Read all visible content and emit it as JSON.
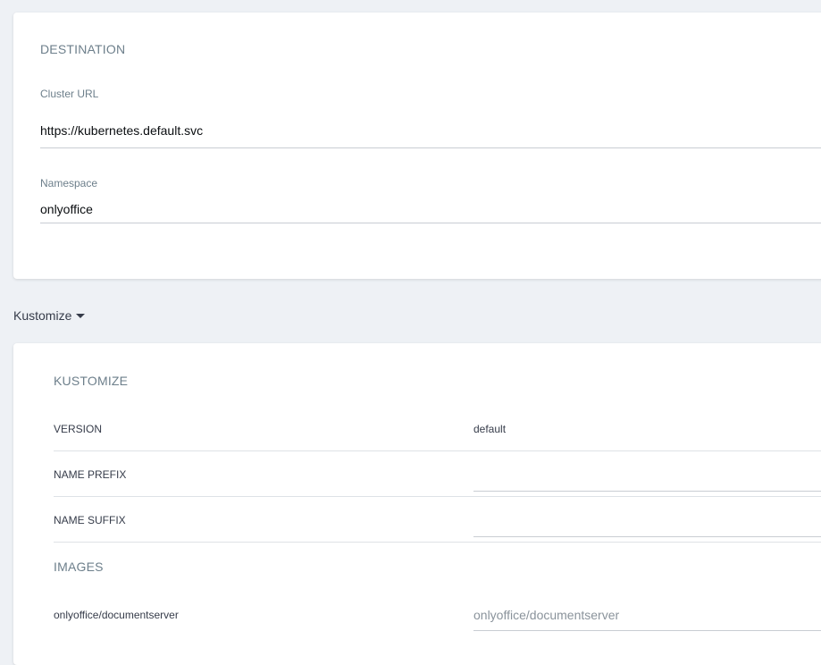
{
  "destination": {
    "title": "DESTINATION",
    "cluster_url": {
      "label": "Cluster URL",
      "value": "https://kubernetes.default.svc"
    },
    "namespace": {
      "label": "Namespace",
      "value": "onlyoffice"
    }
  },
  "tool_selector": {
    "label": "Kustomize"
  },
  "kustomize": {
    "title": "KUSTOMIZE",
    "version": {
      "label": "VERSION",
      "value": "default"
    },
    "name_prefix": {
      "label": "NAME PREFIX",
      "value": ""
    },
    "name_suffix": {
      "label": "NAME SUFFIX",
      "value": ""
    },
    "images": {
      "title": "IMAGES",
      "items": [
        {
          "name": "onlyoffice/documentserver",
          "placeholder": "onlyoffice/documentserver"
        }
      ]
    }
  }
}
